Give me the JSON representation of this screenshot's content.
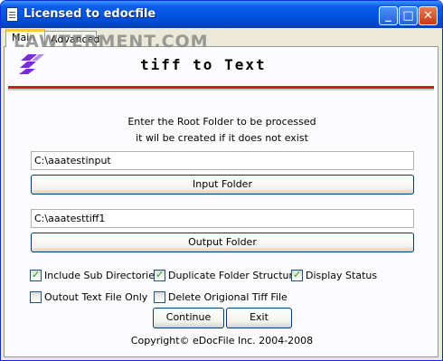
{
  "window": {
    "title": "Licensed to edocfile",
    "minimize_glyph": "_",
    "maximize_glyph": "□",
    "close_glyph": "✕"
  },
  "tabs": [
    {
      "label": "Main",
      "active": true
    },
    {
      "label": "Advanced",
      "active": false
    }
  ],
  "watermark": "LAWTERMENT.COM",
  "header": {
    "logo_icon": "edocfile-logo-icon",
    "title": "tiff to Text",
    "accent_color": "#d7191f",
    "logo_color": "#7b2bd6"
  },
  "instructions": {
    "line1": "Enter the Root Folder to be processed",
    "line2": "it wil be created if it does not exist"
  },
  "input_folder": {
    "value": "C:\\aaatestinput",
    "button_label": "Input Folder"
  },
  "output_folder": {
    "value": "C:\\aaatesttiff1",
    "button_label": "Output Folder"
  },
  "options": [
    {
      "label": "Include Sub Directories",
      "checked": true
    },
    {
      "label": "Duplicate Folder Structure",
      "checked": true
    },
    {
      "label": "Display Status",
      "checked": true
    },
    {
      "label": "Outout Text File Only",
      "checked": false
    },
    {
      "label": "Delete Origional Tiff File",
      "checked": false
    }
  ],
  "buttons": {
    "continue": "Continue",
    "exit": "Exit"
  },
  "copyright": "Copyright© eDocFile Inc. 2004-2008"
}
